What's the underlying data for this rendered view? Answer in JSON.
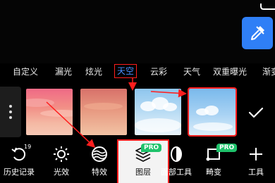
{
  "categories": [
    "自定义",
    "漏光",
    "炫光",
    "天空",
    "云彩",
    "天气",
    "双重曝光",
    "渐变"
  ],
  "active_category": "天空",
  "tools": [
    {
      "label": "历史记录",
      "icon": "history-icon",
      "badge": "19"
    },
    {
      "label": "光效",
      "icon": "light-effect-icon"
    },
    {
      "label": "特效",
      "icon": "special-effect-icon"
    },
    {
      "label": "图层",
      "icon": "layers-icon",
      "pro": "PRO"
    },
    {
      "label": "面部工具",
      "icon": "face-tools-icon"
    },
    {
      "label": "畸变",
      "icon": "distortion-icon",
      "pro": "PRO"
    },
    {
      "label": "工具",
      "icon": "plus-icon"
    }
  ],
  "colors": {
    "accent": "#2f7ff6",
    "highlight": "#ff1e1e",
    "pro_badge": "#1fc26b"
  }
}
